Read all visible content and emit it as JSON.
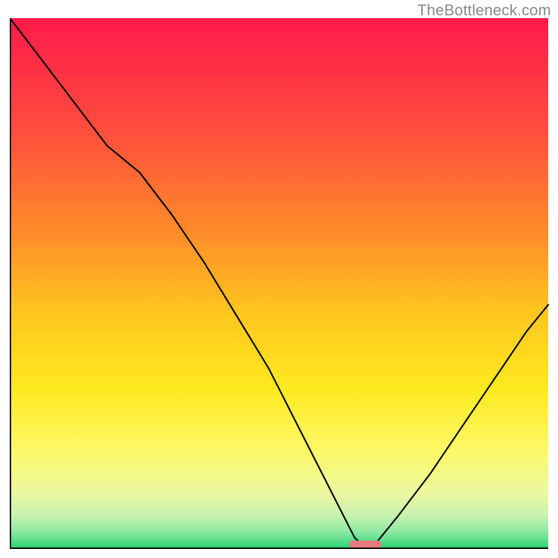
{
  "watermark": "TheBottleneck.com",
  "chart_data": {
    "type": "line",
    "title": "",
    "xlabel": "",
    "ylabel": "",
    "xlim": [
      0,
      100
    ],
    "ylim": [
      0,
      100
    ],
    "grid": false,
    "legend": false,
    "notes": "V-shaped bottleneck curve over vertical red→yellow→green gradient. Minimum around x≈66. Small horizontal pink pill marks the optimum on the x-axis. Watermark at top-right. No axis ticks or numeric labels are visible.",
    "series": [
      {
        "name": "bottleneck-curve",
        "x": [
          0,
          6,
          12,
          18,
          24,
          30,
          36,
          42,
          48,
          54,
          58,
          62,
          64,
          66,
          68,
          72,
          78,
          84,
          90,
          96,
          100
        ],
        "values": [
          100,
          92,
          84,
          76,
          71,
          63,
          54,
          44,
          34,
          22,
          14,
          6,
          2,
          0,
          1,
          6,
          14,
          23,
          32,
          41,
          46
        ]
      }
    ],
    "target_marker": {
      "x_center": 66,
      "width": 6,
      "color": "#e77a80"
    },
    "gradient_stops": [
      {
        "offset": 0.0,
        "color": "#ff1a4b"
      },
      {
        "offset": 0.2,
        "color": "#ff4a3f"
      },
      {
        "offset": 0.4,
        "color": "#ff8a2a"
      },
      {
        "offset": 0.55,
        "color": "#ffc41f"
      },
      {
        "offset": 0.7,
        "color": "#ffe91f"
      },
      {
        "offset": 0.82,
        "color": "#fdf86a"
      },
      {
        "offset": 0.9,
        "color": "#eaf7a0"
      },
      {
        "offset": 0.94,
        "color": "#c7f2af"
      },
      {
        "offset": 0.97,
        "color": "#8de9a3"
      },
      {
        "offset": 1.0,
        "color": "#2ed573"
      }
    ]
  }
}
